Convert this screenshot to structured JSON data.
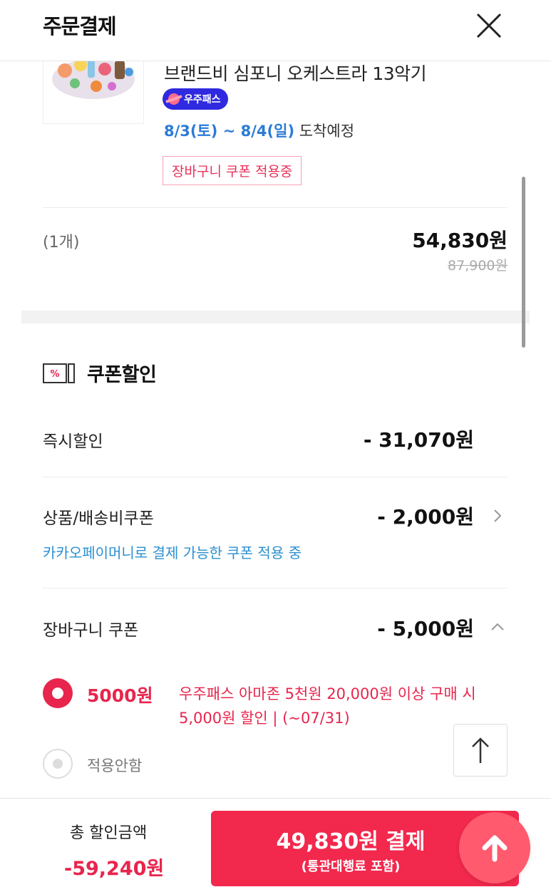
{
  "header": {
    "title": "주문결제",
    "close_icon": "close-icon"
  },
  "product": {
    "name": "브랜드비 심포니 오케스트라 13악기",
    "pass_badge": "우주패스",
    "delivery_date": "8/3(토) ~ 8/4(일)",
    "delivery_suffix": "도착예정",
    "cart_coupon_badge": "장바구니 쿠폰 적용중",
    "quantity": "(1개)",
    "price": "54,830원",
    "original_price": "87,900원"
  },
  "coupon": {
    "section_title": "쿠폰할인",
    "instant": {
      "label": "즉시할인",
      "value": "- 31,070원"
    },
    "product_shipping": {
      "label": "상품/배송비쿠폰",
      "value": "- 2,000원",
      "note": "카카오페이머니로 결제 가능한 쿠폰 적용 중"
    },
    "cart": {
      "label": "장바구니 쿠폰",
      "value": "- 5,000원"
    },
    "options": [
      {
        "amount": "5000원",
        "description": "우주패스 아마존 5천원 20,000원 이상 구매 시 5,000원 할인 | (~07/31)",
        "selected": true
      },
      {
        "label": "적용안함",
        "selected": false
      }
    ]
  },
  "footer": {
    "total_label": "총 할인금액",
    "total_value": "-59,240원",
    "pay_main": "49,830원 결제",
    "pay_sub": "(통관대행료 포함)"
  },
  "colors": {
    "accent": "#f2284d",
    "link": "#2b7bd6",
    "pass": "#2f2ae0",
    "fab": "#ff5a6e"
  },
  "icons": [
    "close-icon",
    "coupon-percent-icon",
    "chevron-right-icon",
    "chevron-up-icon",
    "arrow-up-icon",
    "planet-icon"
  ]
}
